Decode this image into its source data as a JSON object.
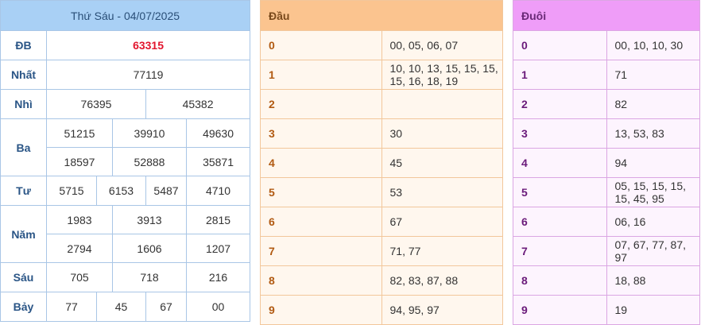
{
  "results": {
    "date_header": "Thứ Sáu - 04/07/2025",
    "prizes": {
      "db": {
        "label": "ĐB",
        "values": [
          "63315"
        ]
      },
      "nhat": {
        "label": "Nhất",
        "values": [
          "77119"
        ]
      },
      "nhi": {
        "label": "Nhì",
        "values": [
          "76395",
          "45382"
        ]
      },
      "ba": {
        "label": "Ba",
        "values": [
          "51215",
          "39910",
          "49630",
          "18597",
          "52888",
          "35871"
        ]
      },
      "tu": {
        "label": "Tư",
        "values": [
          "5715",
          "6153",
          "5487",
          "4710"
        ]
      },
      "nam": {
        "label": "Năm",
        "values": [
          "1983",
          "3913",
          "2815",
          "2794",
          "1606",
          "1207"
        ]
      },
      "sau": {
        "label": "Sáu",
        "values": [
          "705",
          "718",
          "216"
        ]
      },
      "bay": {
        "label": "Bảy",
        "values": [
          "77",
          "45",
          "67",
          "00"
        ]
      }
    }
  },
  "dau": {
    "title": "Đầu",
    "rows": [
      {
        "digit": "0",
        "values": "00, 05, 06, 07"
      },
      {
        "digit": "1",
        "values": "10, 10, 13, 15, 15, 15, 15, 16, 18, 19"
      },
      {
        "digit": "2",
        "values": ""
      },
      {
        "digit": "3",
        "values": "30"
      },
      {
        "digit": "4",
        "values": "45"
      },
      {
        "digit": "5",
        "values": "53"
      },
      {
        "digit": "6",
        "values": "67"
      },
      {
        "digit": "7",
        "values": "71, 77"
      },
      {
        "digit": "8",
        "values": "82, 83, 87, 88"
      },
      {
        "digit": "9",
        "values": "94, 95, 97"
      }
    ]
  },
  "duoi": {
    "title": "Đuôi",
    "rows": [
      {
        "digit": "0",
        "values": "00, 10, 10, 30"
      },
      {
        "digit": "1",
        "values": "71"
      },
      {
        "digit": "2",
        "values": "82"
      },
      {
        "digit": "3",
        "values": "13, 53, 83"
      },
      {
        "digit": "4",
        "values": "94"
      },
      {
        "digit": "5",
        "values": "05, 15, 15, 15, 15, 45, 95"
      },
      {
        "digit": "6",
        "values": "06, 16"
      },
      {
        "digit": "7",
        "values": "07, 67, 77, 87, 97"
      },
      {
        "digit": "8",
        "values": "18, 88"
      },
      {
        "digit": "9",
        "values": "19"
      }
    ]
  },
  "colors": {
    "special_prize": "#e2162e",
    "results_header_bg": "#a9d0f5",
    "dau_header_bg": "#fbc48f",
    "duoi_header_bg": "#ef9df8"
  }
}
